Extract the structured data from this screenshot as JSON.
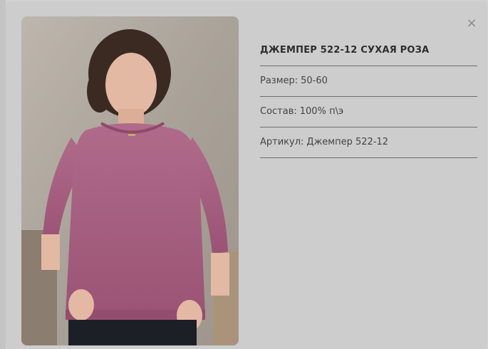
{
  "product": {
    "title": "ДЖЕМПЕР 522-12 СУХАЯ РОЗА",
    "size_label": "Размер:",
    "size_value": "50-60",
    "composition_label": "Состав:",
    "composition_value": "100% п\\э",
    "article_label": "Артикул:",
    "article_value": "Джемпер 522-12"
  },
  "modal": {
    "close_label": "×"
  },
  "image": {
    "subject": "model-in-pink-jumper",
    "top_color": "#a65d7e",
    "background_color": "#b3aca3"
  }
}
